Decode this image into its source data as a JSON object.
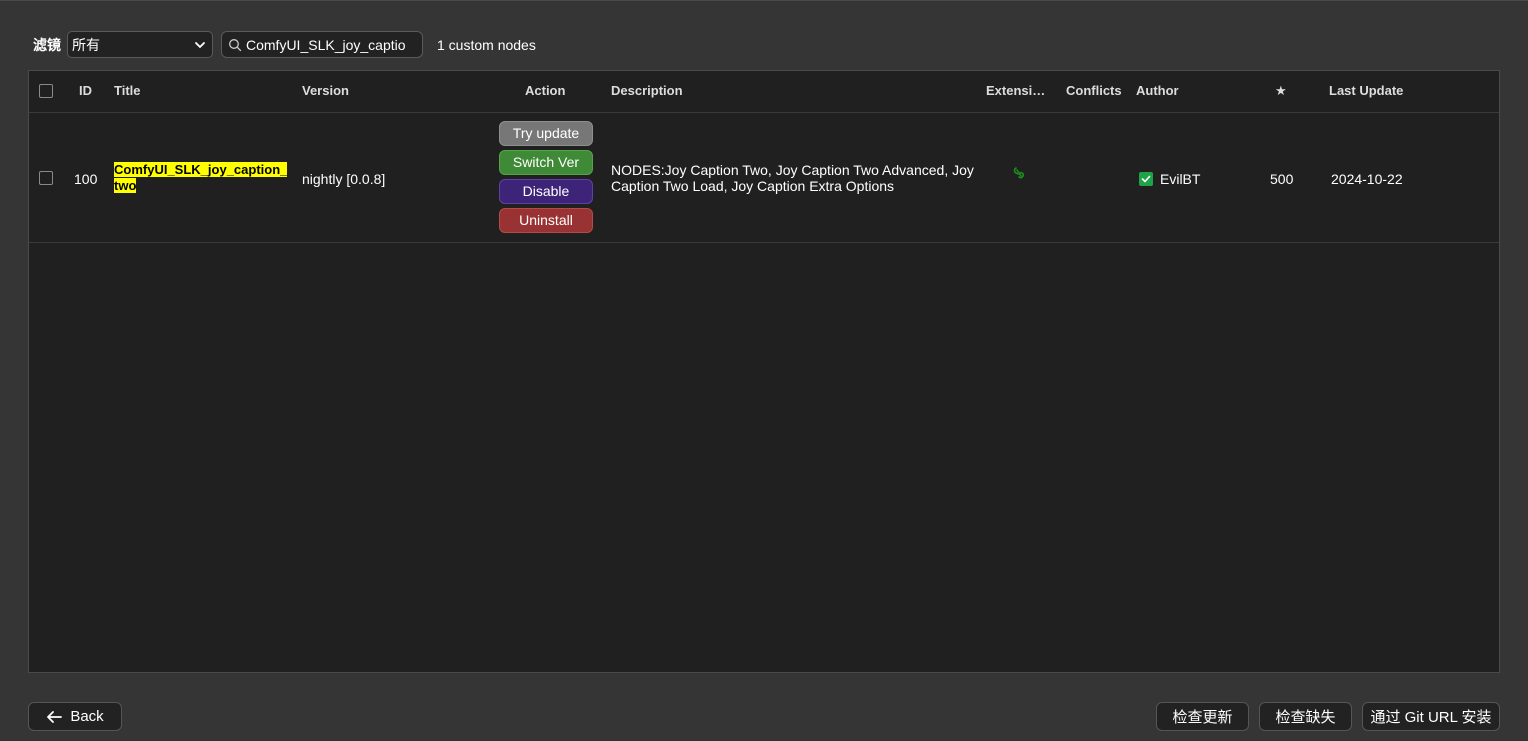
{
  "filter": {
    "label": "滤镜",
    "selected": "所有"
  },
  "search": {
    "value": "ComfyUI_SLK_joy_caption_two"
  },
  "result_count": "1 custom nodes",
  "table": {
    "headers": {
      "id": "ID",
      "title": "Title",
      "version": "Version",
      "action": "Action",
      "description": "Description",
      "extensions": "Extensi…",
      "conflicts": "Conflicts",
      "author": "Author",
      "stars": "★",
      "last_update": "Last Update"
    },
    "rows": [
      {
        "id": "100",
        "title": "ComfyUI_SLK_joy_caption_two",
        "version": "nightly [0.0.8]",
        "actions": {
          "try_update": "Try update",
          "switch_ver": "Switch Ver",
          "disable": "Disable",
          "uninstall": "Uninstall"
        },
        "description": "NODES:Joy Caption Two, Joy Caption Two Advanced, Joy Caption Two Load, Joy Caption Extra Options",
        "extension_icon": "link-icon",
        "conflicts": "",
        "author": "EvilBT",
        "author_verified_icon": "check-icon",
        "stars": "500",
        "last_update": "2024-10-22"
      }
    ]
  },
  "footer": {
    "back": "Back",
    "check_update": "检查更新",
    "check_missing": "检查缺失",
    "install_git_url": "通过 Git URL 安装"
  },
  "colors": {
    "background": "#353535",
    "table_bg": "#202020",
    "highlight": "#ffff00",
    "try_update": "#777777",
    "switch_ver": "#3f8a36",
    "disable": "#3d2478",
    "uninstall": "#993333",
    "verified": "#1fa34a",
    "extension_icon": "#1d8a1d"
  }
}
